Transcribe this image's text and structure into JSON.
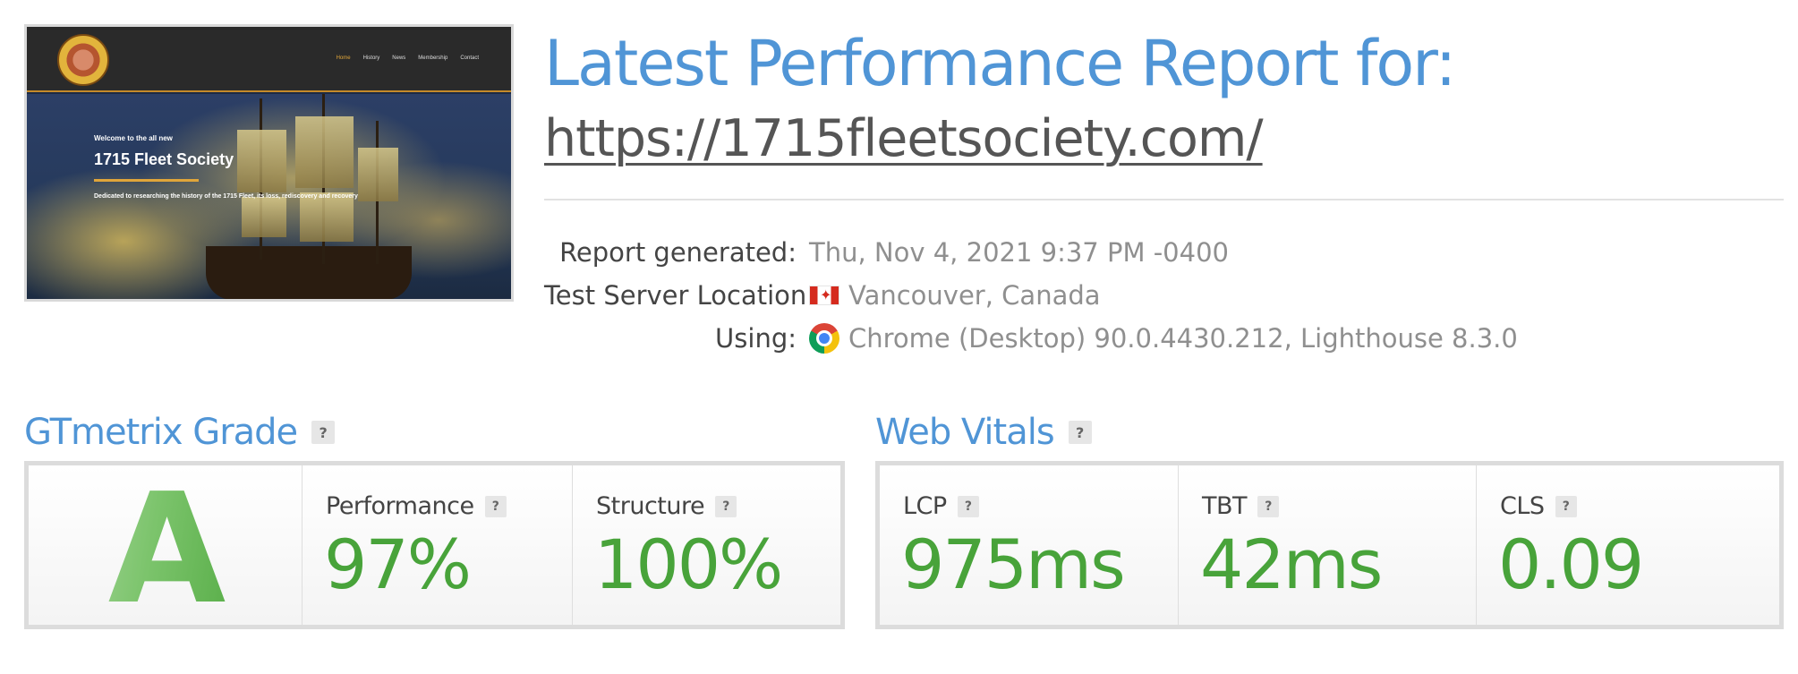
{
  "thumbnail": {
    "nav_items": [
      "Home",
      "History",
      "News",
      "Membership",
      "Contact"
    ],
    "welcome": "Welcome to the all new",
    "site_title": "1715 Fleet Society",
    "tagline": "Dedicated to researching the history of the 1715 Fleet, its loss, rediscovery and recovery"
  },
  "report": {
    "title": "Latest Performance Report for:",
    "url": "https://1715fleetsociety.com/",
    "meta": {
      "generated_label": "Report generated:",
      "generated_value": "Thu, Nov 4, 2021 9:37 PM -0400",
      "location_label": "Test Server Location:",
      "location_value": "Vancouver, Canada",
      "using_label": "Using:",
      "using_value": "Chrome (Desktop) 90.0.4430.212, Lighthouse 8.3.0"
    }
  },
  "grade": {
    "heading": "GTmetrix Grade",
    "help": "?",
    "letter": "A",
    "performance_label": "Performance",
    "performance_value": "97%",
    "structure_label": "Structure",
    "structure_value": "100%"
  },
  "vitals": {
    "heading": "Web Vitals",
    "help": "?",
    "lcp_label": "LCP",
    "lcp_value": "975ms",
    "tbt_label": "TBT",
    "tbt_value": "42ms",
    "cls_label": "CLS",
    "cls_value": "0.09"
  },
  "colors": {
    "heading_blue": "#5095d6",
    "value_green": "#48a33a"
  },
  "icons": {
    "location": "canada-flag-icon",
    "browser": "chrome-icon",
    "help": "help-icon"
  }
}
